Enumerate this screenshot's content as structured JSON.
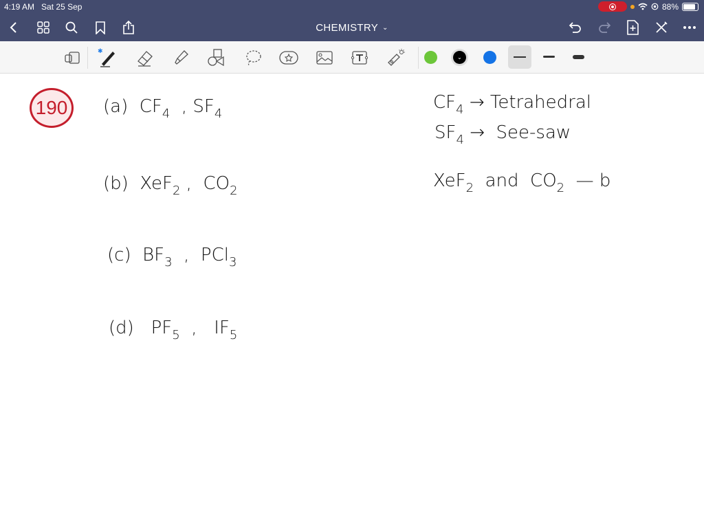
{
  "status_bar": {
    "time": "4:19 AM",
    "date": "Sat 25 Sep",
    "battery": "88%"
  },
  "nav": {
    "title": "CHEMISTRY",
    "left_icons": [
      "back-icon",
      "grid-icon",
      "search-icon",
      "bookmark-icon",
      "share-icon"
    ],
    "right_icons": [
      "undo-icon",
      "redo-icon",
      "add-page-icon",
      "close-icon",
      "more-icon"
    ]
  },
  "toolbar": {
    "tools": [
      "read-mode",
      "pen",
      "eraser",
      "highlighter",
      "shapes",
      "lasso",
      "sticker",
      "image",
      "text",
      "laser-pointer"
    ],
    "colors": [
      "#6cc63a",
      "#000000",
      "#1473e6"
    ],
    "selected_color": "#000000",
    "stroke_widths": [
      "thin",
      "medium",
      "thick"
    ],
    "selected_stroke": "thin"
  },
  "note": {
    "question_number": "190",
    "options": [
      {
        "label": "(a)",
        "first": "CF",
        "first_sub": "4",
        "second": "SF",
        "second_sub": "4"
      },
      {
        "label": "(b)",
        "first": "XeF",
        "first_sub": "2",
        "second": "CO",
        "second_sub": "2"
      },
      {
        "label": "(c)",
        "first": "BF",
        "first_sub": "3",
        "second": "PCl",
        "second_sub": "3"
      },
      {
        "label": "(d)",
        "first": "PF",
        "first_sub": "5",
        "second": "IF",
        "second_sub": "5"
      }
    ],
    "answers": [
      {
        "formula": "CF",
        "sub": "4",
        "arrow": "→",
        "shape": "Tetrahedral"
      },
      {
        "formula": "SF",
        "sub": "4",
        "arrow": "→",
        "shape": "See-saw"
      }
    ],
    "conclusion": {
      "a": "XeF",
      "a_sub": "2",
      "and": "and",
      "b": "CO",
      "b_sub": "2",
      "dash": "—",
      "answer": "b"
    },
    "comma": ","
  }
}
